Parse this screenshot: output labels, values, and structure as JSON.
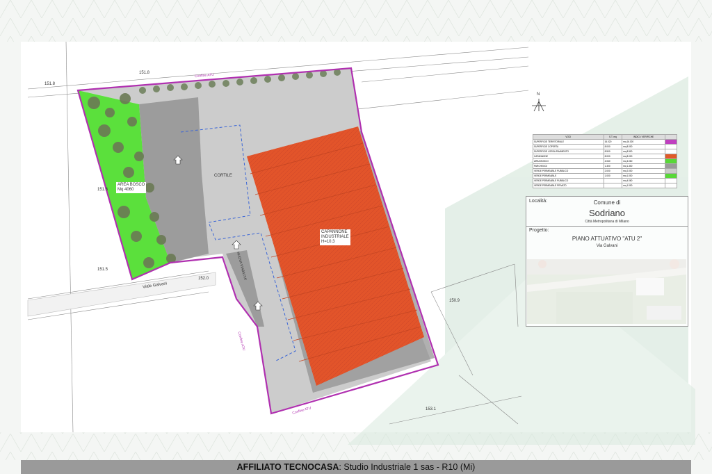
{
  "labels": {
    "aula_bosco": "AREA BOSCO",
    "aula_bosco_mq": "Mq 4060",
    "cortile": "CORTILE",
    "capannone": "CAPANNONE",
    "capannone_2": "INDUSTRIALE",
    "capannone_3": "H=10.3",
    "viale": "Viale Galvani",
    "nuova_strada": "NUOVA VIABILITA'",
    "confine_1": "Confine ATU",
    "confine_2": "Confine ATU",
    "confine_3": "Confine ATU",
    "quota_1": "151.8",
    "quota_2": "151.6",
    "quota_3": "152.0",
    "quota_4": "150.9",
    "quota_5": "151.8",
    "quota_6": "151.5",
    "quota_7": "153.1",
    "north": "N"
  },
  "legend": {
    "header": [
      "VOCI",
      "S.T. mq",
      "INDICI / VERIFICHE"
    ],
    "rows": [
      [
        "SUPERFICIE TERRITORIALE",
        "16.020",
        "mq 16.020"
      ],
      [
        "SUPERFICIE COPERTA",
        "8.000",
        "mq 8.000"
      ],
      [
        "SUPERFICIE LORDA PAVIMENTO",
        "8.500",
        "mq 8.500"
      ],
      [
        "CAPANNONE",
        "8.000",
        "mq 8.000"
      ],
      [
        "AREA BOSCO",
        "4.060",
        "mq 4.060"
      ],
      [
        "PARCHEGGI",
        "1.300",
        "mq 1.300"
      ],
      [
        "VERDE PERMEABILE PUBBLICO",
        "2.000",
        "mq 2.000"
      ],
      [
        "VERDE PERMEABILE",
        "1.000",
        "mq 1.000"
      ],
      [
        "VERDE PERMEABILE PUBBLICO",
        "",
        "mq 4.060"
      ],
      [
        "VERDE PERMEABILE PRIVATO",
        "",
        "mq 1.000"
      ]
    ],
    "swatches": [
      "#c040c0",
      "#ffffff",
      "#ffffff",
      "#e05a28",
      "#58d838",
      "#9a9a9a",
      "#cccccc",
      "#58d838",
      "#ffffff",
      "#ffffff"
    ]
  },
  "title_box": {
    "localita_label": "Località:",
    "comune": "Comune di",
    "city": "Sodriano",
    "city_sub": "Città Metropolitana di Milano",
    "progetto_label": "Progetto:",
    "project": "PIANO ATTUATIVO \"ATU 2\"",
    "project_sub": "Via Galvani"
  },
  "footer": {
    "bold": "AFFILIATO TECNOCASA",
    "rest": ": Studio Industriale 1 sas - R10 (Mi)"
  },
  "colors": {
    "building": "#e2542a",
    "forest": "#5be03c",
    "paving": "#c8c8c8",
    "parking": "#9c9c9c",
    "boundary": "#b030b0",
    "watermark": "#cfe3d6"
  }
}
